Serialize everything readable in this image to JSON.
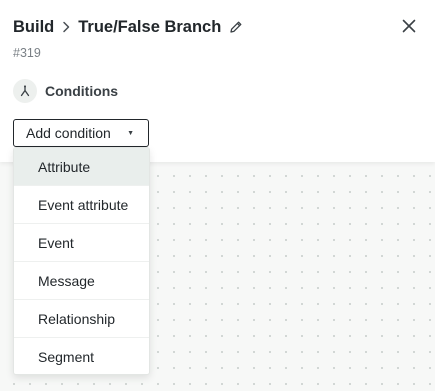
{
  "header": {
    "breadcrumb_root": "Build",
    "title": "True/False Branch",
    "node_id": "#319"
  },
  "icons": {
    "chevron": "chevron-right-icon",
    "edit": "pencil-icon",
    "close": "close-icon",
    "branch": "branch-icon",
    "caret": "caret-down-icon"
  },
  "conditions": {
    "title": "Conditions",
    "add_button_label": "Add condition",
    "caret": "▼"
  },
  "menu": {
    "items": [
      {
        "label": "Attribute",
        "active": true
      },
      {
        "label": "Event attribute",
        "active": false
      },
      {
        "label": "Event",
        "active": false
      },
      {
        "label": "Message",
        "active": false
      },
      {
        "label": "Relationship",
        "active": false
      },
      {
        "label": "Segment",
        "active": false
      }
    ]
  },
  "colors": {
    "text": "#22272b",
    "muted": "#7a8086",
    "hover_bg": "#e9eeec",
    "canvas_bg": "#f7f8f7",
    "dot": "#c9cfcc"
  }
}
